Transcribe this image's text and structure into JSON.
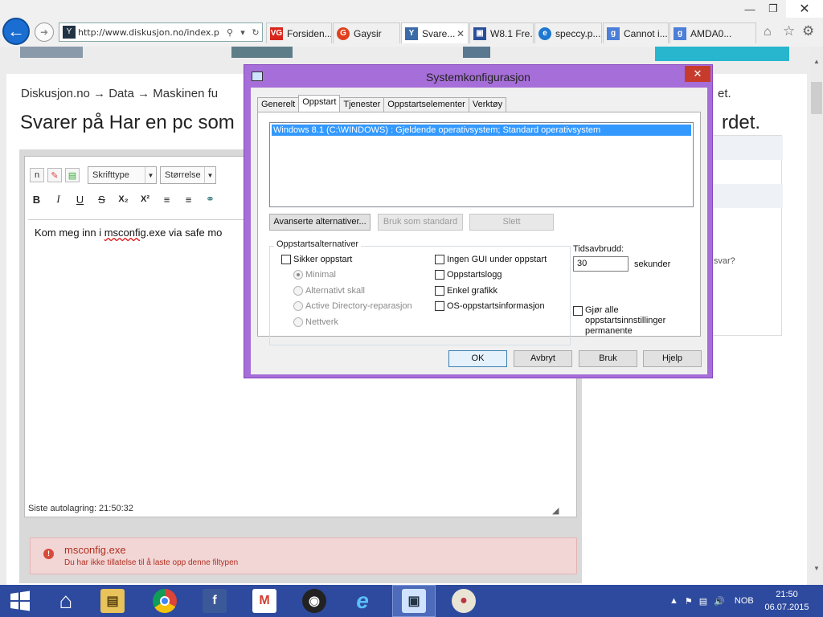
{
  "browser": {
    "url": "http://www.diskusjon.no/index.p",
    "tabs": [
      {
        "label": "Forsiden...",
        "icon": "vg-icon",
        "color": "#d8261c"
      },
      {
        "label": "Gaysir",
        "icon": "gaysir-icon",
        "color": "#e0401e"
      },
      {
        "label": "Svare...",
        "icon": "diskusjon-icon",
        "color": "#3a6aa8",
        "active": true
      },
      {
        "label": "W8.1 Fre...",
        "icon": "monitor-icon",
        "color": "#2a4f9a"
      },
      {
        "label": "speccy.p...",
        "icon": "ie-icon",
        "color": "#1e78d2"
      },
      {
        "label": "Cannot i...",
        "icon": "google-icon",
        "color": "#4c7fd8"
      },
      {
        "label": "AMDA0...",
        "icon": "google-icon",
        "color": "#4c7fd8"
      }
    ]
  },
  "page": {
    "breadcrumb": "Diskusjon.no → Data → Maskinen fu",
    "breadcrumb_tail": "et.",
    "title": "Svarer på Har en pc som",
    "title_tail": "rdet.",
    "editor": {
      "font_select": "Skrifttype",
      "size_select": "Størrelse",
      "text_before": "Kom meg inn i  ",
      "text_misspelled": "msconfig",
      "text_after": ".exe via safe mo",
      "autosave": "Siste autolagring: 21:50:32"
    },
    "error": {
      "title": "msconfig.exe",
      "message": "Du har ikke tillatelse til å laste opp denne filtypen"
    },
    "side_text": "or svar?"
  },
  "dialog": {
    "title": "Systemkonfigurasjon",
    "tabs": [
      "Generelt",
      "Oppstart",
      "Tjenester",
      "Oppstartselementer",
      "Verktøy"
    ],
    "os_entry": "Windows 8.1 (C:\\WINDOWS) : Gjeldende operativsystem; Standard operativsystem",
    "advanced_button": "Avanserte alternativer...",
    "set_default_button": "Bruk som standard",
    "delete_button": "Slett",
    "group_label": "Oppstartsalternativer",
    "safe_boot": "Sikker oppstart",
    "radio_minimal": "Minimal",
    "radio_alt_shell": "Alternativt skall",
    "radio_ad_repair": "Active Directory-reparasjon",
    "radio_network": "Nettverk",
    "no_gui": "Ingen GUI under oppstart",
    "boot_log": "Oppstartslogg",
    "base_video": "Enkel grafikk",
    "os_boot_info": "OS-oppstartsinformasjon",
    "timeout_label": "Tidsavbrudd:",
    "timeout_value": "30",
    "timeout_unit": "sekunder",
    "make_permanent": "Gjør alle oppstartsinnstillinger permanente",
    "ok": "OK",
    "cancel": "Avbryt",
    "apply": "Bruk",
    "help": "Hjelp"
  },
  "taskbar": {
    "language": "NOB",
    "time": "21:50",
    "date": "06.07.2015"
  },
  "colors": {
    "dialog_border": "#a66ed8",
    "taskbar": "#2d4a9e",
    "error_bg": "#f2d6d6",
    "selection": "#3399ff"
  }
}
